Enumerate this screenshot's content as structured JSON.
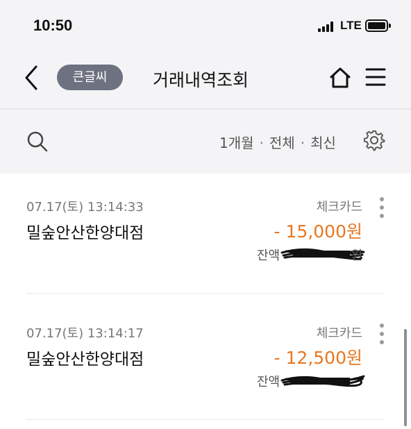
{
  "status_bar": {
    "time": "10:50",
    "network": "LTE"
  },
  "nav": {
    "back_icon": "chevron-left-icon",
    "font_size_pill": "큰글씨",
    "title": "거래내역조회",
    "home_icon": "home-icon",
    "menu_icon": "hamburger-menu-icon"
  },
  "filter": {
    "search_icon": "search-icon",
    "period": "1개월",
    "scope": "전체",
    "order": "최신",
    "separator": "·",
    "settings_icon": "gear-icon"
  },
  "transactions": [
    {
      "datetime": "07.17(토) 13:14:33",
      "merchant": "밀숲안산한양대점",
      "type": "체크카드",
      "amount": "- 15,000원",
      "balance_label": "잔액",
      "balance_unit": "원"
    },
    {
      "datetime": "07.17(토) 13:14:17",
      "merchant": "밀숲안산한양대점",
      "type": "체크카드",
      "amount": "- 12,500원",
      "balance_label": "잔액",
      "balance_unit": ""
    }
  ],
  "colors": {
    "amount_withdrawal": "#e87722",
    "pill_background": "#6e7180",
    "header_background": "#f4f4f6"
  }
}
